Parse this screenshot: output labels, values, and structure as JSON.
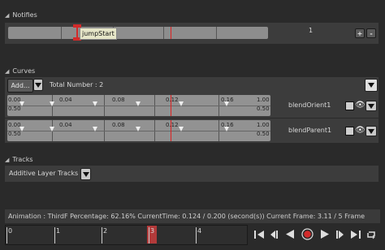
{
  "notifies": {
    "title": "Notifies",
    "notify_label": "jumpStart",
    "track_number": "1",
    "add_label": "+",
    "remove_label": "-"
  },
  "curves": {
    "title": "Curves",
    "add_label": "Add...",
    "total_label": "Total Number : 2",
    "items": [
      {
        "name": "blendOrient1",
        "ticks": [
          "0.00",
          "0.04",
          "0.08",
          "0.12",
          "0.16",
          "1.00"
        ],
        "low_left": "0.50",
        "low_right": "0.50"
      },
      {
        "name": "blendParent1",
        "ticks": [
          "0.00",
          "0.04",
          "0.08",
          "0.12",
          "0.16",
          "1.00"
        ],
        "low_left": "0.50",
        "low_right": "0.50"
      }
    ]
  },
  "tracks": {
    "title": "Tracks",
    "additive_label": "Additive Layer Tracks"
  },
  "status": {
    "text": "Animation : ThirdF Percentage:  62.16% CurrentTime:  0.124 / 0.200 (second(s)) Current Frame:  3.11 / 5 Frame"
  },
  "timeline": {
    "marks": [
      "0",
      "1",
      "2",
      "3",
      "4"
    ],
    "current_frame_progress": 0.6216
  },
  "colors": {
    "accent_red": "#d22a2a",
    "panel": "#3c3c3c",
    "track": "#929292"
  }
}
